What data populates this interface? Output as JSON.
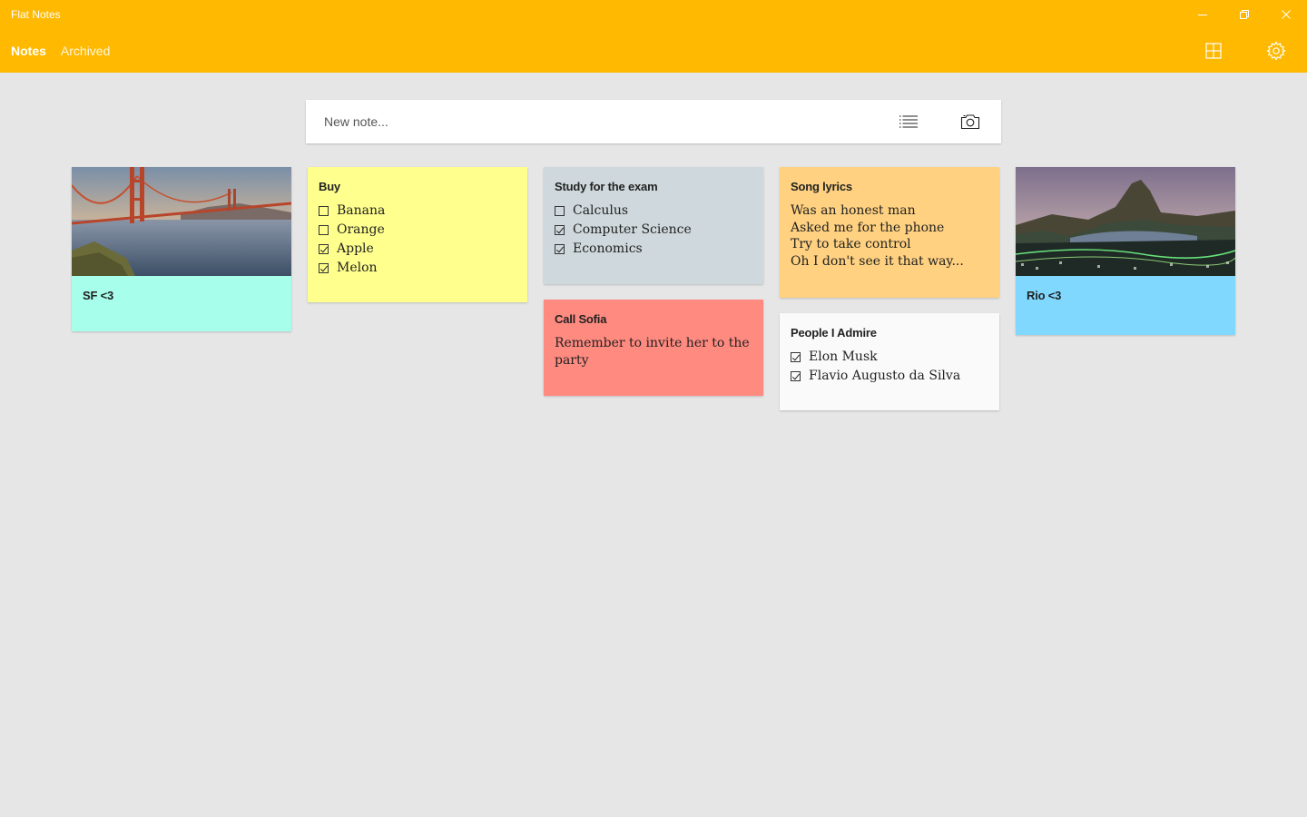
{
  "window": {
    "title": "Flat Notes",
    "controls": {
      "minimize": "minimize",
      "restore": "restore",
      "close": "close"
    }
  },
  "nav": {
    "tabs": [
      {
        "label": "Notes",
        "active": true
      },
      {
        "label": "Archived",
        "active": false
      }
    ]
  },
  "header_icons": [
    "grid-view-icon",
    "settings-gear-icon"
  ],
  "new_note": {
    "placeholder": "New note...",
    "icons": [
      "checklist-icon",
      "camera-icon"
    ]
  },
  "colors": {
    "accent": "#ffb900",
    "background": "#e6e6e6",
    "note_mint": "#a7ffeb",
    "note_yellow": "#ffff8d",
    "note_gray": "#cfd8dc",
    "note_orange": "#ffd180",
    "note_red": "#ff8a80",
    "note_white": "#fafafa",
    "note_blue": "#80d8ff"
  },
  "notes": {
    "sf": {
      "title": "SF <3",
      "image": "golden-gate-bridge-photo"
    },
    "buy": {
      "title": "Buy",
      "items": [
        {
          "text": "Banana",
          "checked": false
        },
        {
          "text": "Orange",
          "checked": false
        },
        {
          "text": "Apple",
          "checked": true
        },
        {
          "text": "Melon",
          "checked": true
        }
      ]
    },
    "study": {
      "title": "Study for the exam",
      "items": [
        {
          "text": "Calculus",
          "checked": false
        },
        {
          "text": "Computer Science",
          "checked": true
        },
        {
          "text": "Economics",
          "checked": true
        }
      ]
    },
    "call": {
      "title": "Call Sofia",
      "lines": [
        "Remember to invite her to the",
        "party"
      ]
    },
    "song": {
      "title": "Song lyrics",
      "lines": [
        "Was an honest man",
        "Asked me for the phone",
        "Try to take control",
        "Oh I don't see it that way..."
      ]
    },
    "people": {
      "title": "People I Admire",
      "items": [
        {
          "text": "Elon Musk",
          "checked": true
        },
        {
          "text": "Flavio Augusto da Silva",
          "checked": true
        }
      ]
    },
    "rio": {
      "title": "Rio <3",
      "image": "rio-de-janeiro-photo"
    }
  }
}
